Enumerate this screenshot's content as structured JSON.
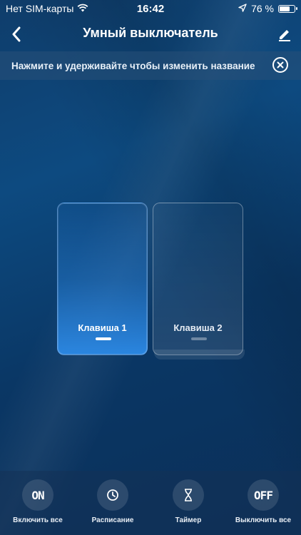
{
  "status_bar": {
    "carrier": "Нет SIM-карты",
    "time": "16:42",
    "battery_percent_text": "76 %",
    "battery_level": 0.76,
    "icons": [
      "wifi-icon",
      "location-arrow-icon",
      "battery-icon"
    ]
  },
  "nav": {
    "title": "Умный выключатель",
    "back_icon": "chevron-left-icon",
    "edit_icon": "pencil-icon"
  },
  "hint": {
    "text": "Нажмите и удерживайте чтобы изменить название",
    "close_icon": "close-circle-icon"
  },
  "keys": [
    {
      "label": "Клавиша 1",
      "state": "on"
    },
    {
      "label": "Клавиша 2",
      "state": "off"
    }
  ],
  "actions": [
    {
      "icon_text": "ON",
      "label": "Включить все"
    },
    {
      "icon": "clock-icon",
      "label": "Расписание"
    },
    {
      "icon": "hourglass-icon",
      "label": "Таймер"
    },
    {
      "icon_text": "OFF",
      "label": "Выключить все"
    }
  ],
  "colors": {
    "accent": "#2b86e0",
    "background": "#0d4a80"
  }
}
